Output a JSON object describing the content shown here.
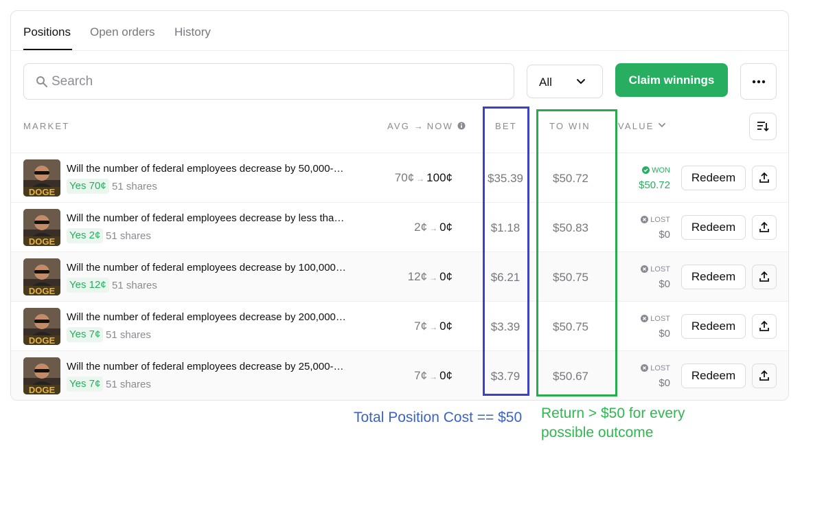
{
  "tabs": [
    {
      "label": "Positions",
      "active": true
    },
    {
      "label": "Open orders",
      "active": false
    },
    {
      "label": "History",
      "active": false
    }
  ],
  "search": {
    "placeholder": "Search",
    "icon": "search-icon"
  },
  "filter": {
    "value": "All",
    "icon": "chevron-down-icon"
  },
  "claim_button": "Claim winnings",
  "more_icon": "more-horizontal-icon",
  "columns": {
    "market": "MARKET",
    "avg_now": "AVG",
    "now": "NOW",
    "bet": "BET",
    "to_win": "TO WIN",
    "value": "VALUE"
  },
  "thumb_text": "DOGE",
  "colors": {
    "accent": "#27ae60",
    "annotation_blue": "#3b3fc9",
    "annotation_green": "#26ad4a"
  },
  "rows": [
    {
      "question": "Will the number of federal employees decrease by 50,000-…",
      "outcome": "Yes 70¢",
      "shares": "51 shares",
      "avg": "70¢",
      "now": "100¢",
      "bet": "$35.39",
      "to_win": "$50.72",
      "status": "WON",
      "value": "$50.72",
      "action": "Redeem"
    },
    {
      "question": "Will the number of federal employees decrease by less tha…",
      "outcome": "Yes 2¢",
      "shares": "51 shares",
      "avg": "2¢",
      "now": "0¢",
      "bet": "$1.18",
      "to_win": "$50.83",
      "status": "LOST",
      "value": "$0",
      "action": "Redeem"
    },
    {
      "question": "Will the number of federal employees decrease by 100,000…",
      "outcome": "Yes 12¢",
      "shares": "51 shares",
      "avg": "12¢",
      "now": "0¢",
      "bet": "$6.21",
      "to_win": "$50.75",
      "status": "LOST",
      "value": "$0",
      "action": "Redeem"
    },
    {
      "question": "Will the number of federal employees decrease by 200,000…",
      "outcome": "Yes 7¢",
      "shares": "51 shares",
      "avg": "7¢",
      "now": "0¢",
      "bet": "$3.39",
      "to_win": "$50.75",
      "status": "LOST",
      "value": "$0",
      "action": "Redeem"
    },
    {
      "question": "Will the number of federal employees decrease by 25,000-…",
      "outcome": "Yes 7¢",
      "shares": "51 shares",
      "avg": "7¢",
      "now": "0¢",
      "bet": "$3.79",
      "to_win": "$50.67",
      "status": "LOST",
      "value": "$0",
      "action": "Redeem"
    }
  ],
  "annotations": {
    "blue": "Total Position Cost == $50",
    "green": "Return > $50 for every possible outcome"
  }
}
